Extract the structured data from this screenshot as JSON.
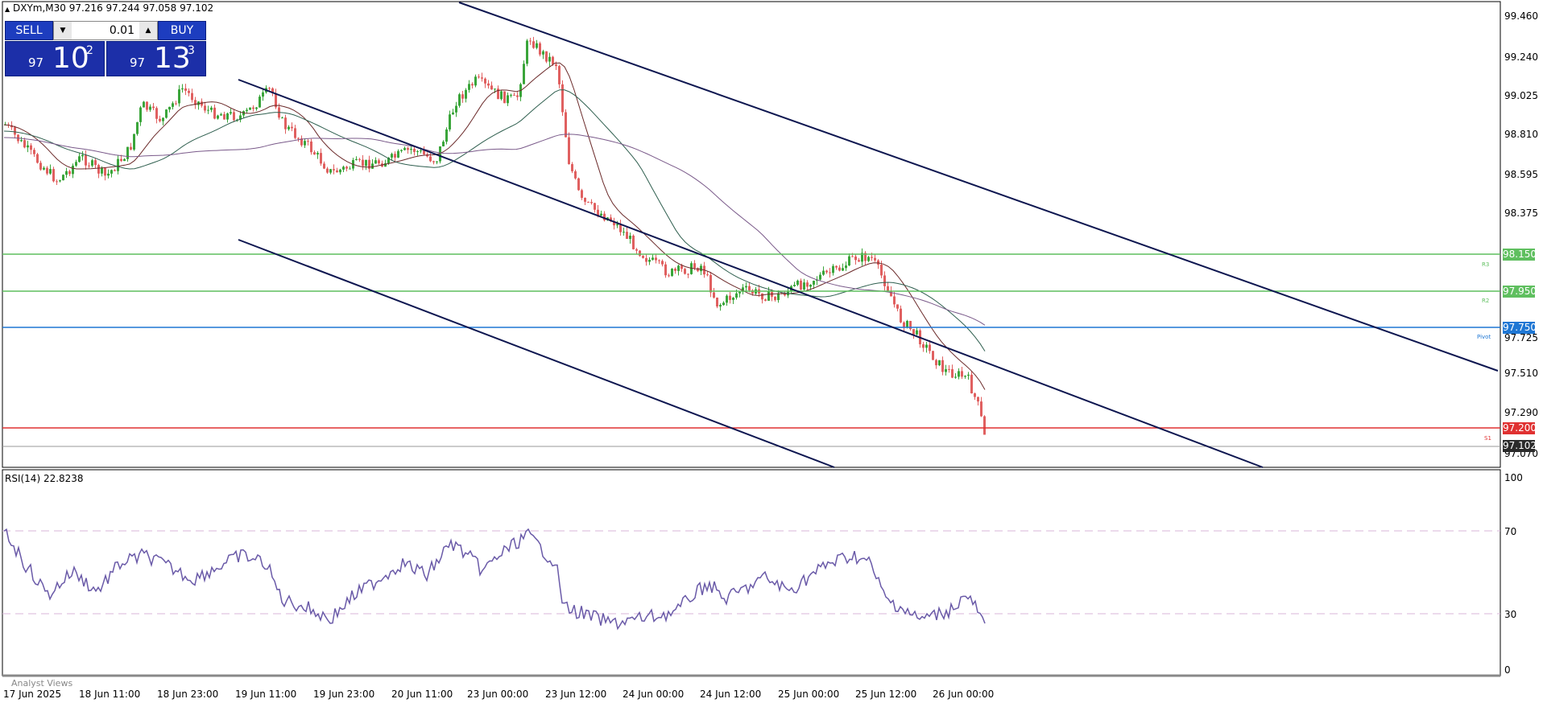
{
  "header": {
    "symbol_title": "DXYm,M30  97.216 97.244 97.058 97.102"
  },
  "trade_panel": {
    "sell_label": "SELL",
    "buy_label": "BUY",
    "lot": "0.01",
    "bid_prefix": "97",
    "bid_big": "10",
    "bid_sup": "2",
    "ask_prefix": "97",
    "ask_big": "13",
    "ask_sup": "3"
  },
  "price_axis": [
    "99.460",
    "99.240",
    "99.025",
    "98.810",
    "98.595",
    "98.375",
    "97.510",
    "97.290",
    "97.070"
  ],
  "price_axis_partial": "97.725",
  "levels": {
    "r3": {
      "value": "98.150",
      "label": "R3",
      "color": "#5fbf5f"
    },
    "r2": {
      "value": "97.950",
      "label": "R2",
      "color": "#5fbf5f"
    },
    "pivot": {
      "value": "97.750",
      "label": "Pivot",
      "color": "#1f77d4"
    },
    "s1": {
      "value": "97.200",
      "label": "S1",
      "color": "#e03131"
    },
    "current": {
      "value": "97.102",
      "color": "#2b2b2b"
    }
  },
  "time_axis": [
    "17 Jun 2025",
    "18 Jun 11:00",
    "18 Jun 23:00",
    "19 Jun 11:00",
    "19 Jun 23:00",
    "20 Jun 11:00",
    "23 Jun 00:00",
    "23 Jun 12:00",
    "24 Jun 00:00",
    "24 Jun 12:00",
    "25 Jun 00:00",
    "25 Jun 12:00",
    "26 Jun 00:00"
  ],
  "rsi": {
    "title": "RSI(14) 22.8238",
    "levels": [
      "100",
      "70",
      "30",
      "0"
    ]
  },
  "footer": {
    "analyst_views": "Analyst Views"
  },
  "colors": {
    "bull": "#3aa53a",
    "bear": "#e06060",
    "channel": "#0d1650",
    "rsi_line": "#6a5aa8"
  }
}
